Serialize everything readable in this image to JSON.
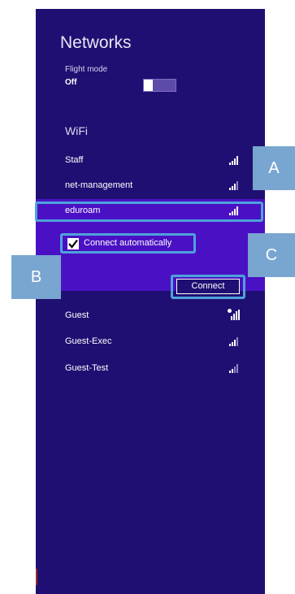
{
  "panel": {
    "title": "Networks",
    "flight_mode": {
      "label": "Flight mode",
      "value": "Off"
    },
    "wifi_heading": "WiFi",
    "networks": [
      {
        "name": "Staff",
        "icon": "wifi-signal-icon"
      },
      {
        "name": "net-management",
        "icon": "wifi-signal-icon"
      },
      {
        "name": "eduroam",
        "icon": "wifi-signal-icon",
        "selected": true
      },
      {
        "name": "Guest",
        "icon": "wifi-open-signal-icon"
      },
      {
        "name": "Guest-Exec",
        "icon": "wifi-signal-icon"
      },
      {
        "name": "Guest-Test",
        "icon": "wifi-signal-icon"
      }
    ],
    "connect_automatically": {
      "label": "Connect automatically",
      "checked": true
    },
    "connect_label": "Connect"
  },
  "callouts": {
    "a": "A",
    "b": "B",
    "c": "C"
  },
  "colors": {
    "panel_bg": "#200f72",
    "selected_bg": "#4a11c4",
    "highlight_border": "#4ea3d9",
    "callout_bg": "#79a6d0"
  }
}
